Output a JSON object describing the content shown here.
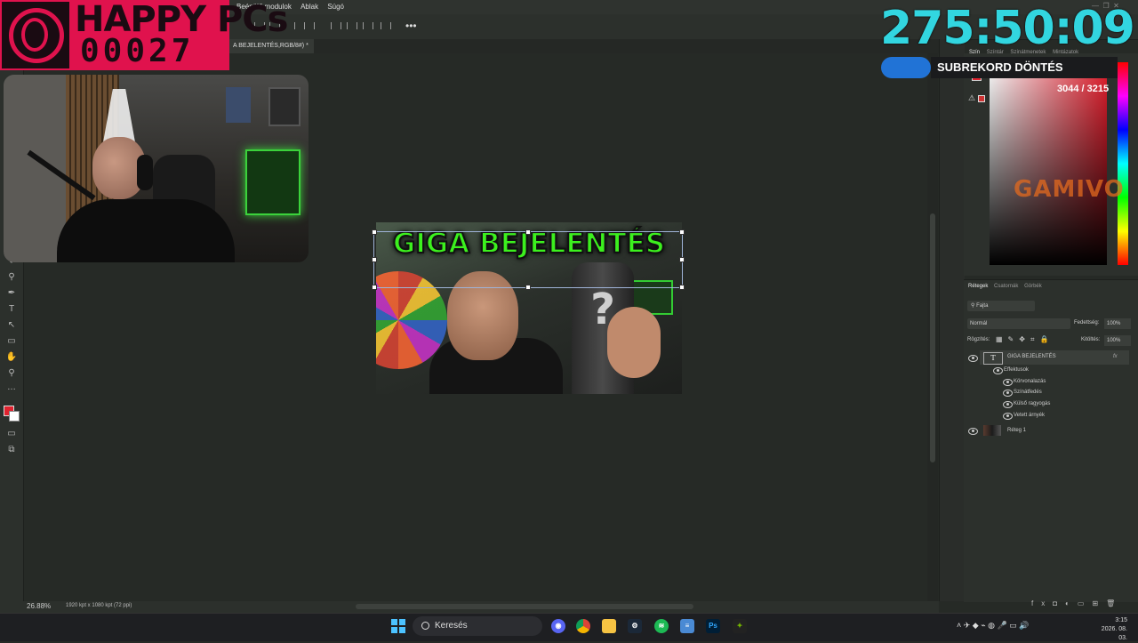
{
  "menu": {
    "items": [
      "Beépülő modulok",
      "Ablak",
      "Súgó"
    ]
  },
  "document": {
    "tab_title": "A BEJELENTÉS,RGB/8#) *",
    "zoom": "26.88%",
    "size_info": "1920 kpt x 1080 kpt (72 ppi)",
    "thumbnail_title": "GIGA BEJELENTÉS",
    "thumbnail_question": "?"
  },
  "color_panel": {
    "tabs": [
      "Szín",
      "Színtár",
      "Színátmenetek",
      "Mintázatok"
    ],
    "active_tab": "Szín",
    "foreground": "#e1232f"
  },
  "layers_panel": {
    "tabs": [
      "Rétegek",
      "Csatornák",
      "Görbék"
    ],
    "active_tab": "Rétegek",
    "filter": "Fajta",
    "blend_mode": "Normál",
    "opacity_label": "Fedettség:",
    "opacity_value": "100%",
    "lock_label": "Rögzítés:",
    "fill_label": "Kitöltés:",
    "fill_value": "100%",
    "layers": [
      {
        "name": "GIGA BEJELENTÉS",
        "type": "text",
        "fx": "fx"
      },
      {
        "name": "Réteg 1",
        "type": "image"
      }
    ],
    "effects_label": "Effektusok",
    "effects": [
      "Körvonalazás",
      "Színátfedés",
      "Külső ragyogás",
      "Vetett árnyék"
    ]
  },
  "stream_overlay": {
    "brand": "HAPPY PCs",
    "brand_count": "00027",
    "timer": "275:50:09",
    "sub_banner": "SUBREKORD DÖNTÉS",
    "sub_count": "3044 / 3215",
    "sponsor": "GAMIVO",
    "accent": "#e0124d",
    "timer_color": "#32d6e0"
  },
  "taskbar": {
    "search_placeholder": "Keresés",
    "apps": [
      "discord-icon",
      "chrome-icon",
      "file-explorer-icon",
      "steam-icon",
      "spotify-icon",
      "notepad-icon",
      "photoshop-icon",
      "nvidia-icon"
    ],
    "photoshop_label": "Ps",
    "clock_time": "3:15",
    "clock_date": "2026. 08. 03."
  }
}
